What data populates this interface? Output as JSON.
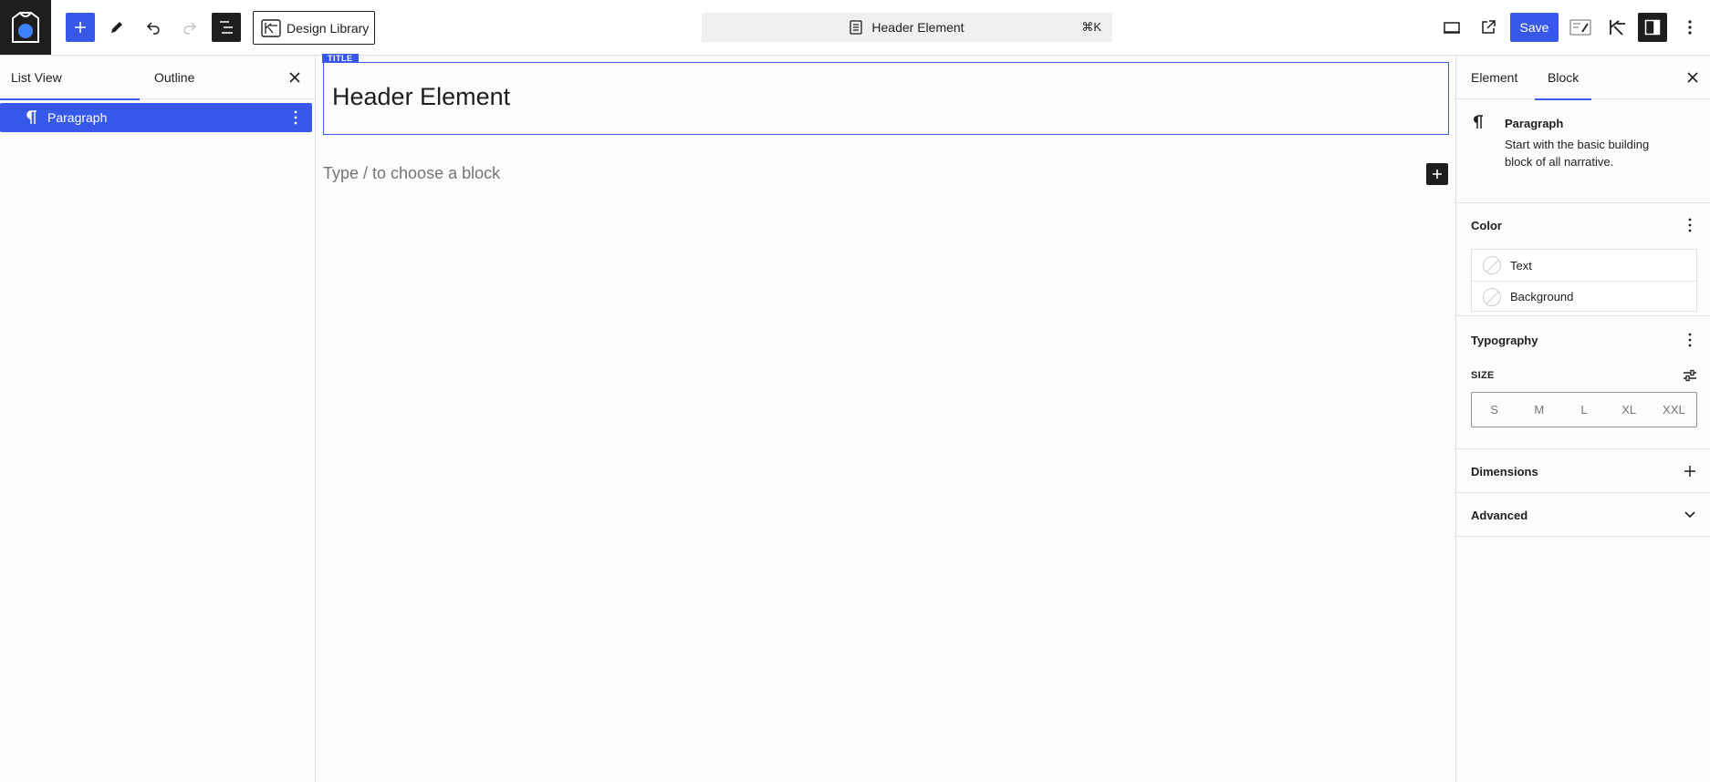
{
  "toolbar": {
    "design_library_label": "Design Library",
    "document_title": "Header Element",
    "command_shortcut": "⌘K",
    "save_label": "Save",
    "icons": [
      "site-logo",
      "plus-icon",
      "pencil-icon",
      "undo-icon",
      "redo-icon",
      "list-view-icon",
      "design-library-icon",
      "document-icon",
      "desktop-preview-icon",
      "external-link-icon",
      "style-book-icon",
      "plugin-icon",
      "sidebar-toggle-icon",
      "more-vertical-icon"
    ]
  },
  "left_panel": {
    "tabs": [
      {
        "label": "List View",
        "active": true
      },
      {
        "label": "Outline",
        "active": false
      }
    ],
    "items": [
      {
        "label": "Paragraph",
        "icon": "paragraph-icon",
        "selected": true
      }
    ]
  },
  "canvas": {
    "title_tag": "TITLE",
    "title": "Header Element",
    "placeholder": "Type / to choose a block"
  },
  "sidebar": {
    "tabs": [
      {
        "label": "Element",
        "active": false
      },
      {
        "label": "Block",
        "active": true
      }
    ],
    "block_card": {
      "title": "Paragraph",
      "description": "Start with the basic building block of all narrative."
    },
    "color": {
      "title": "Color",
      "items": [
        "Text",
        "Background"
      ]
    },
    "typography": {
      "title": "Typography",
      "size_label": "SIZE",
      "sizes": [
        "S",
        "M",
        "L",
        "XL",
        "XXL"
      ]
    },
    "dimensions": {
      "title": "Dimensions"
    },
    "advanced": {
      "title": "Advanced"
    }
  },
  "colors": {
    "accent": "#3858e9",
    "dark": "#1e1e1e",
    "border": "#e0e0e0",
    "muted_text": "#757575"
  }
}
